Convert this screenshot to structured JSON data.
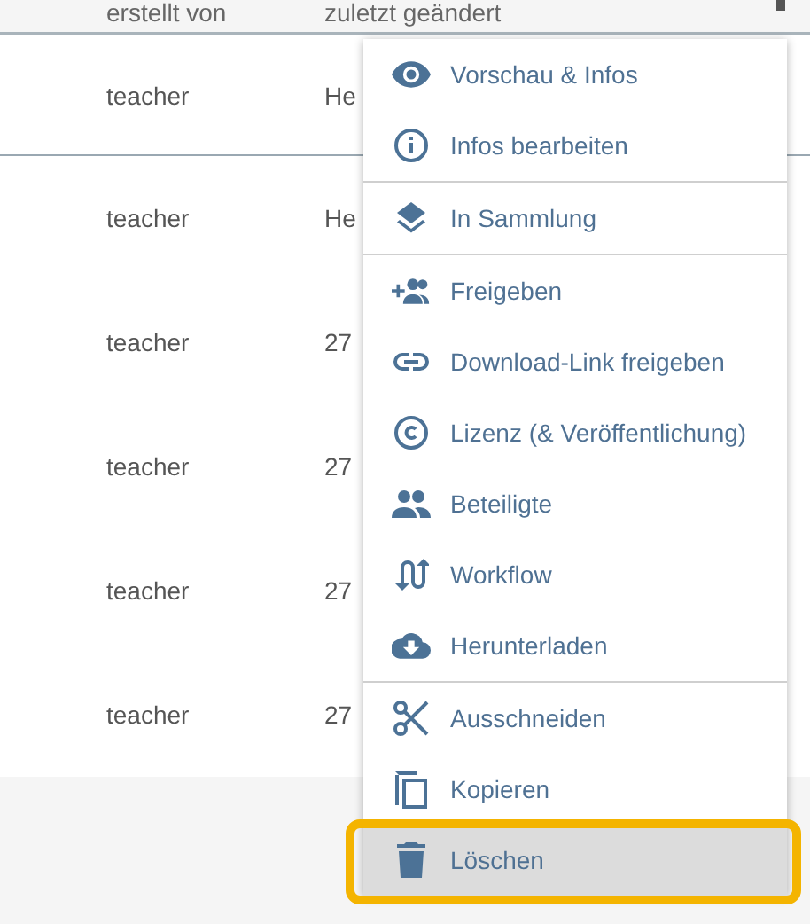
{
  "table": {
    "columns": [
      "erstellt von",
      "zuletzt geändert"
    ],
    "rows": [
      {
        "creator": "teacher",
        "modified": "He"
      },
      {
        "creator": "teacher",
        "modified": "He"
      },
      {
        "creator": "teacher",
        "modified": "27"
      },
      {
        "creator": "teacher",
        "modified": "27"
      },
      {
        "creator": "teacher",
        "modified": "27"
      },
      {
        "creator": "teacher",
        "modified": "27"
      }
    ]
  },
  "context_menu": {
    "groups": [
      {
        "items": [
          {
            "label": "Vorschau & Infos",
            "highlighted": false
          },
          {
            "label": "Infos bearbeiten",
            "highlighted": false
          }
        ]
      },
      {
        "items": [
          {
            "label": "In Sammlung",
            "highlighted": false
          }
        ]
      },
      {
        "items": [
          {
            "label": "Freigeben",
            "highlighted": false
          },
          {
            "label": "Download-Link freigeben",
            "highlighted": false
          },
          {
            "label": "Lizenz (& Veröffentlichung)",
            "highlighted": false
          },
          {
            "label": "Beteiligte",
            "highlighted": false
          },
          {
            "label": "Workflow",
            "highlighted": false
          },
          {
            "label": "Herunterladen",
            "highlighted": false
          }
        ]
      },
      {
        "items": [
          {
            "label": "Ausschneiden",
            "highlighted": false
          },
          {
            "label": "Kopieren",
            "highlighted": false
          },
          {
            "label": "Löschen",
            "highlighted": true
          }
        ]
      }
    ]
  }
}
